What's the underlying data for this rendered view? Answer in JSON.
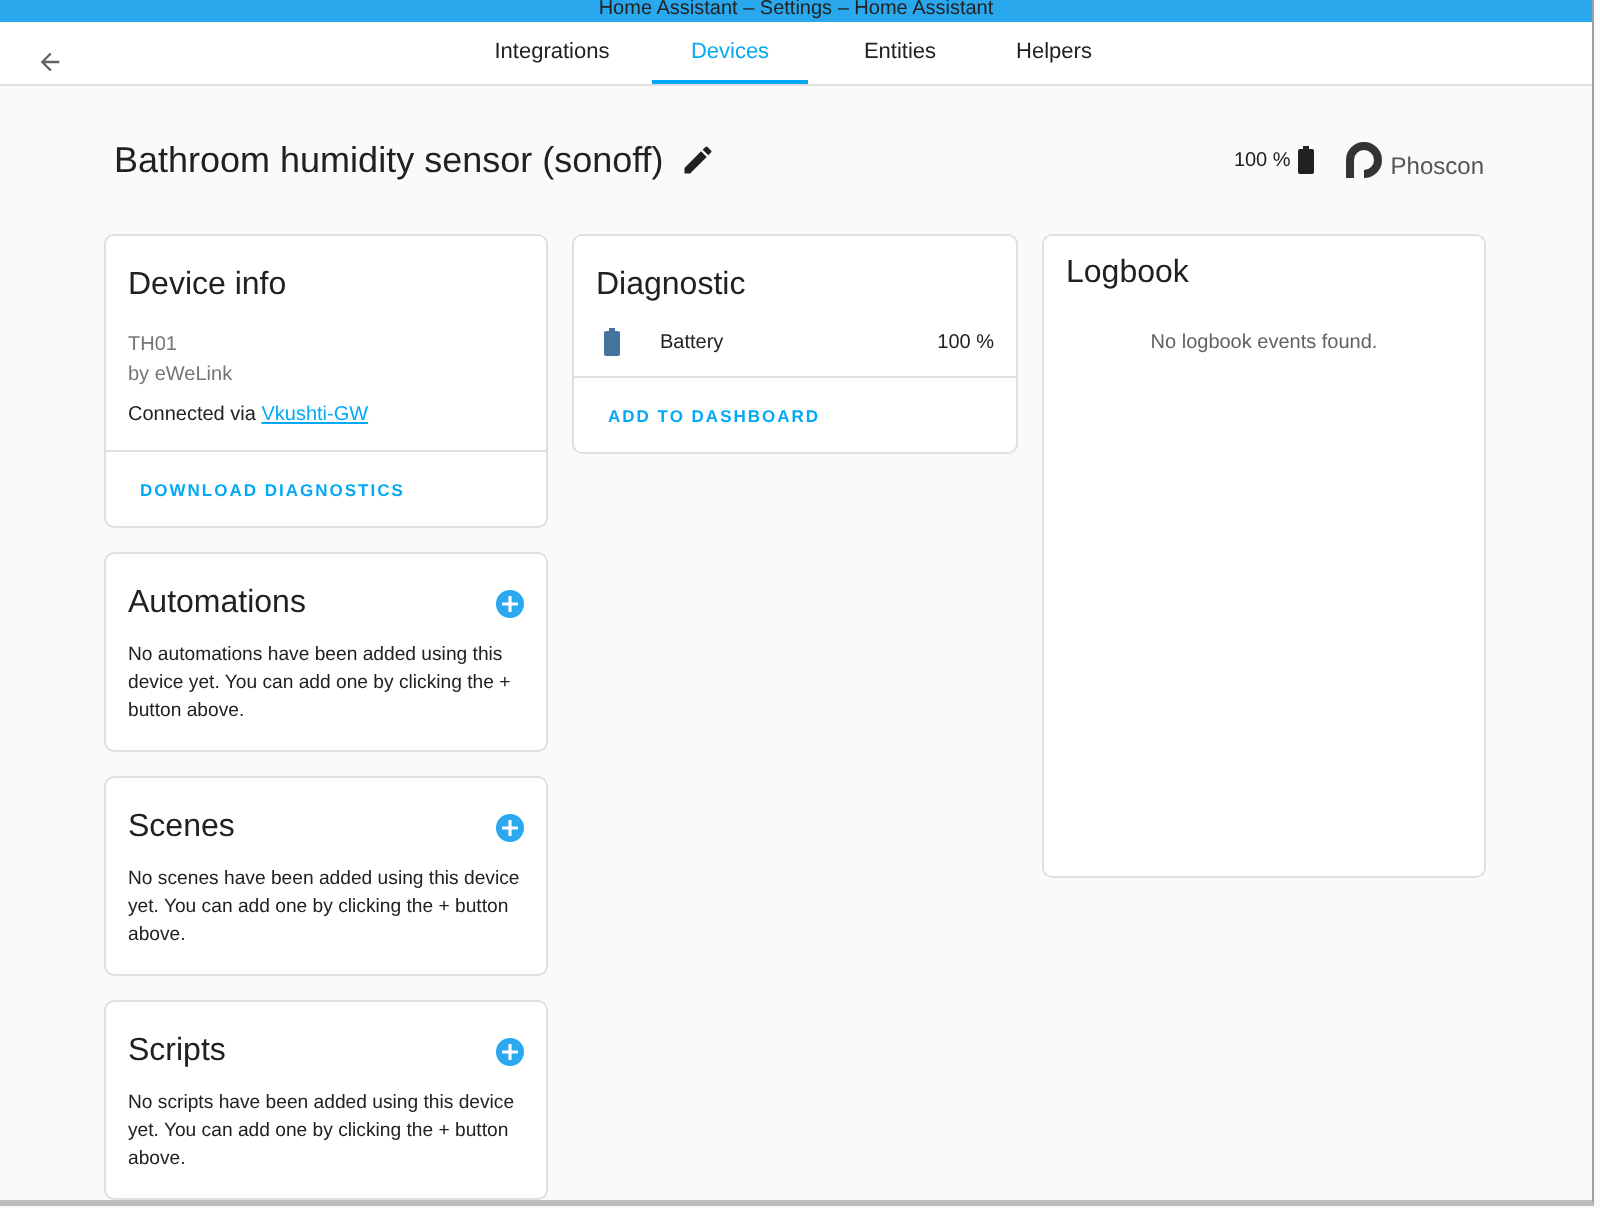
{
  "window": {
    "title": "Home Assistant – Settings – Home Assistant"
  },
  "tabs": [
    {
      "label": "Integrations",
      "selected": false
    },
    {
      "label": "Devices",
      "selected": true
    },
    {
      "label": "Entities",
      "selected": false
    },
    {
      "label": "Helpers",
      "selected": false
    }
  ],
  "header": {
    "title": "Bathroom humidity sensor (sonoff)",
    "battery": "100 %",
    "brand": "Phoscon"
  },
  "device_info": {
    "title": "Device info",
    "model": "TH01",
    "manufacturer": "by eWeLink",
    "connected_prefix": "Connected via",
    "connected_link": "Vkushti-GW",
    "action": "DOWNLOAD DIAGNOSTICS"
  },
  "sections": [
    {
      "title": "Automations",
      "text": "No automations have been added using this device yet. You can add one by clicking the + button above."
    },
    {
      "title": "Scenes",
      "text": "No scenes have been added using this device yet. You can add one by clicking the + button above."
    },
    {
      "title": "Scripts",
      "text": "No scripts have been added using this device yet. You can add one by clicking the + button above."
    }
  ],
  "diagnostic": {
    "title": "Diagnostic",
    "rows": [
      {
        "name": "Battery",
        "value": "100 %"
      }
    ],
    "action": "ADD TO DASHBOARD"
  },
  "logbook": {
    "title": "Logbook",
    "empty": "No logbook events found."
  }
}
